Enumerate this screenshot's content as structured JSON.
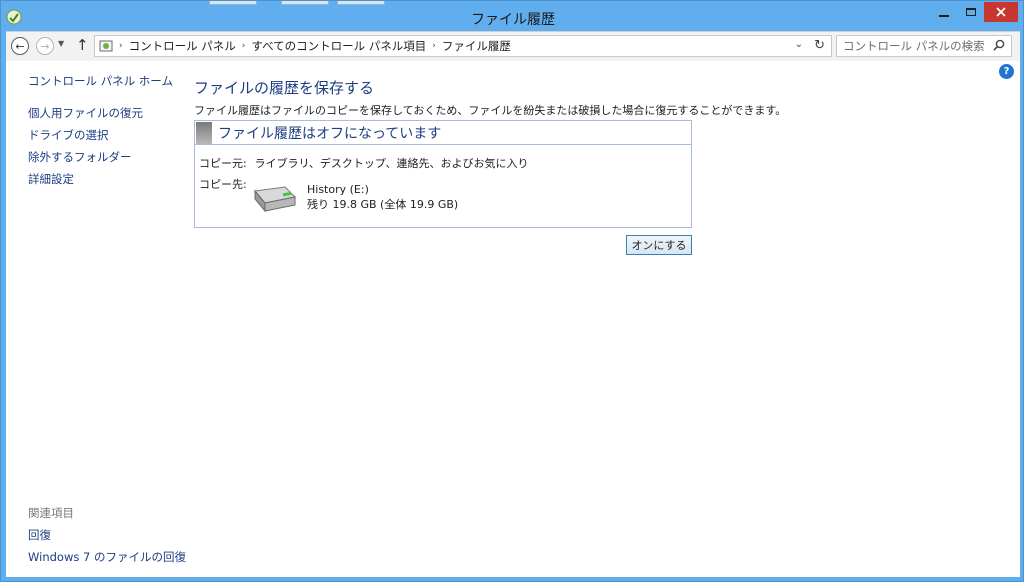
{
  "window": {
    "title": "ファイル履歴"
  },
  "nav": {
    "breadcrumb": [
      "コントロール パネル",
      "すべてのコントロール パネル項目",
      "ファイル履歴"
    ]
  },
  "search": {
    "placeholder": "コントロール パネルの検索"
  },
  "sidebar": {
    "home": "コントロール パネル ホーム",
    "items": [
      {
        "label": "個人用ファイルの復元"
      },
      {
        "label": "ドライブの選択"
      },
      {
        "label": "除外するフォルダー"
      },
      {
        "label": "詳細設定"
      }
    ],
    "related_title": "関連項目",
    "related": [
      {
        "label": "回復"
      },
      {
        "label": "Windows 7 のファイルの回復"
      }
    ]
  },
  "main": {
    "title": "ファイルの履歴を保存する",
    "description": "ファイル履歴はファイルのコピーを保存しておくため、ファイルを紛失または破損した場合に復元することができます。",
    "status_title": "ファイル履歴はオフになっています",
    "copy_from_label": "コピー元:",
    "copy_from_value": "ライブラリ、デスクトップ、連絡先、およびお気に入り",
    "copy_to_label": "コピー先:",
    "drive_name": "History (E:)",
    "drive_space": "残り 19.8 GB (全体 19.9 GB)",
    "turn_on_button": "オンにする"
  },
  "icons": {
    "back": "back-arrow-icon",
    "forward": "forward-arrow-icon",
    "up": "up-arrow-icon",
    "refresh": "refresh-icon",
    "search": "search-icon",
    "help": "help-icon",
    "drive": "hard-drive-icon"
  },
  "colors": {
    "titlebar": "#61aeee",
    "close_button": "#c7372f",
    "link": "#1c3d82",
    "panel_border": "#a9bcd9"
  }
}
